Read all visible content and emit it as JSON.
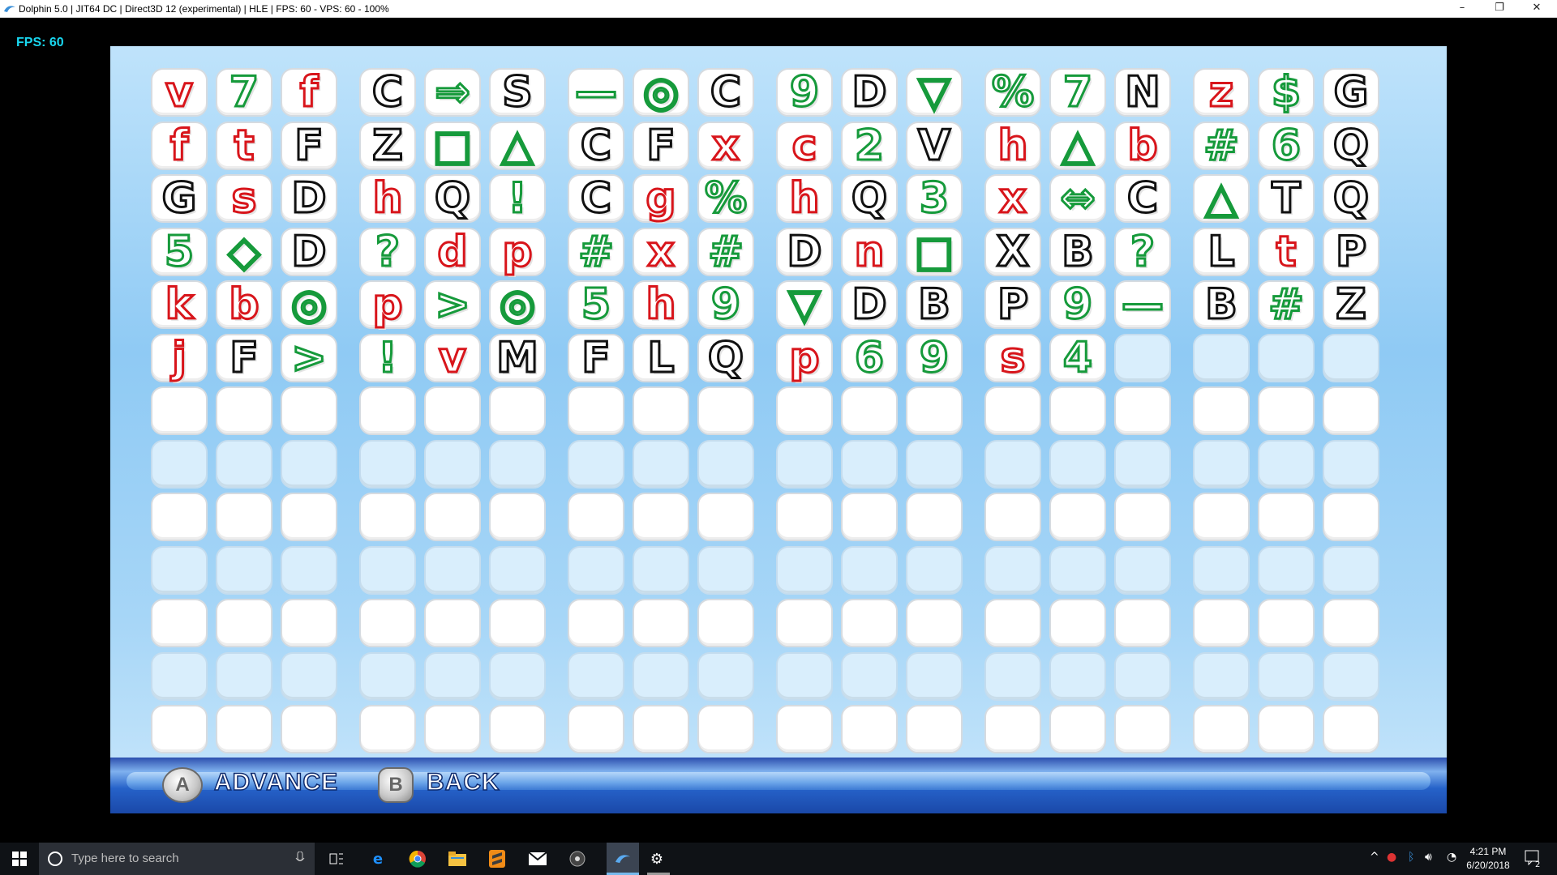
{
  "window": {
    "title": "Dolphin 5.0 | JIT64 DC | Direct3D 12 (experimental) | HLE | FPS: 60 - VPS: 60 - 100%",
    "minimize": "–",
    "restore": "❐",
    "close": "✕"
  },
  "overlay": {
    "fps": "FPS: 60"
  },
  "grid": {
    "rows": [
      [
        [
          "v",
          "red"
        ],
        [
          "7",
          "green"
        ],
        [
          "f",
          "red"
        ],
        [
          "C",
          "black"
        ],
        [
          "⇒",
          "green"
        ],
        [
          "S",
          "black"
        ],
        [
          "—",
          "green"
        ],
        [
          "◎",
          "green"
        ],
        [
          "C",
          "black"
        ],
        [
          "9",
          "green"
        ],
        [
          "D",
          "black"
        ],
        [
          "▽",
          "green"
        ],
        [
          "%",
          "green"
        ],
        [
          "7",
          "green"
        ],
        [
          "N",
          "black"
        ],
        [
          "z",
          "red"
        ],
        [
          "$",
          "green"
        ],
        [
          "G",
          "black"
        ]
      ],
      [
        [
          "f",
          "red"
        ],
        [
          "t",
          "red"
        ],
        [
          "F",
          "black"
        ],
        [
          "Z",
          "black"
        ],
        [
          "□",
          "green"
        ],
        [
          "△",
          "green"
        ],
        [
          "C",
          "black"
        ],
        [
          "F",
          "black"
        ],
        [
          "x",
          "red"
        ],
        [
          "c",
          "red"
        ],
        [
          "2",
          "green"
        ],
        [
          "V",
          "black"
        ],
        [
          "h",
          "red"
        ],
        [
          "△",
          "green"
        ],
        [
          "b",
          "red"
        ],
        [
          "#",
          "green"
        ],
        [
          "6",
          "green"
        ],
        [
          "Q",
          "black"
        ]
      ],
      [
        [
          "G",
          "black"
        ],
        [
          "s",
          "red"
        ],
        [
          "D",
          "black"
        ],
        [
          "h",
          "red"
        ],
        [
          "Q",
          "black"
        ],
        [
          "!",
          "green"
        ],
        [
          "C",
          "black"
        ],
        [
          "g",
          "red"
        ],
        [
          "%",
          "green"
        ],
        [
          "h",
          "red"
        ],
        [
          "Q",
          "black"
        ],
        [
          "3",
          "green"
        ],
        [
          "x",
          "red"
        ],
        [
          "⇔",
          "green"
        ],
        [
          "C",
          "black"
        ],
        [
          "△",
          "green"
        ],
        [
          "T",
          "black"
        ],
        [
          "Q",
          "black"
        ]
      ],
      [
        [
          "5",
          "green"
        ],
        [
          "◇",
          "green"
        ],
        [
          "D",
          "black"
        ],
        [
          "?",
          "green"
        ],
        [
          "d",
          "red"
        ],
        [
          "p",
          "red"
        ],
        [
          "#",
          "green"
        ],
        [
          "x",
          "red"
        ],
        [
          "#",
          "green"
        ],
        [
          "D",
          "black"
        ],
        [
          "n",
          "red"
        ],
        [
          "□",
          "green"
        ],
        [
          "X",
          "black"
        ],
        [
          "B",
          "black"
        ],
        [
          "?",
          "green"
        ],
        [
          "L",
          "black"
        ],
        [
          "t",
          "red"
        ],
        [
          "P",
          "black"
        ]
      ],
      [
        [
          "k",
          "red"
        ],
        [
          "b",
          "red"
        ],
        [
          "◎",
          "green"
        ],
        [
          "p",
          "red"
        ],
        [
          ">",
          "green"
        ],
        [
          "◎",
          "green"
        ],
        [
          "5",
          "green"
        ],
        [
          "h",
          "red"
        ],
        [
          "9",
          "green"
        ],
        [
          "▽",
          "green"
        ],
        [
          "D",
          "black"
        ],
        [
          "B",
          "black"
        ],
        [
          "P",
          "black"
        ],
        [
          "9",
          "green"
        ],
        [
          "—",
          "green"
        ],
        [
          "B",
          "black"
        ],
        [
          "#",
          "green"
        ],
        [
          "Z",
          "black"
        ]
      ],
      [
        [
          "j",
          "red"
        ],
        [
          "F",
          "black"
        ],
        [
          ">",
          "green"
        ],
        [
          "!",
          "green"
        ],
        [
          "v",
          "red"
        ],
        [
          "M",
          "black"
        ],
        [
          "F",
          "black"
        ],
        [
          "L",
          "black"
        ],
        [
          "Q",
          "black"
        ],
        [
          "p",
          "red"
        ],
        [
          "6",
          "green"
        ],
        [
          "9",
          "green"
        ],
        [
          "s",
          "red"
        ],
        [
          "4",
          "green"
        ],
        null,
        null,
        null,
        null
      ]
    ],
    "total_rows": 13,
    "columns": 18
  },
  "bottom_bar": {
    "a_button": "A",
    "advance_label": "ADVANCE",
    "b_button": "B",
    "back_label": "BACK"
  },
  "taskbar": {
    "search_placeholder": "Type here to search",
    "time": "4:21 PM",
    "date": "6/20/2018",
    "notification_count": "2"
  },
  "colors": {
    "red": "#d8151b",
    "green": "#169a3b",
    "black": "#111111",
    "fps": "#19d7f0"
  }
}
